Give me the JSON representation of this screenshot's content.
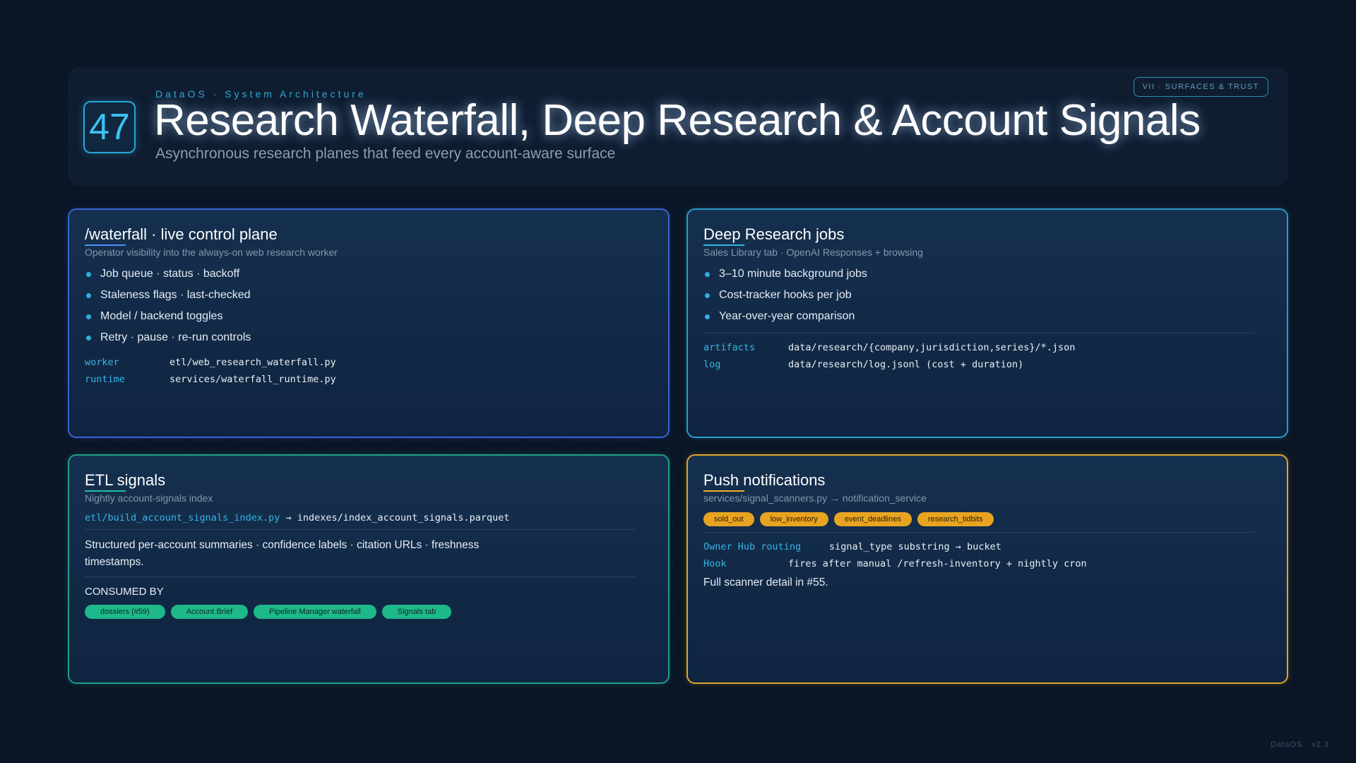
{
  "header": {
    "slide_number": "47",
    "eyebrow": "DataOS · System Architecture",
    "title": "Research Waterfall, Deep Research & Account Signals",
    "subtitle": "Asynchronous research planes that feed every account-aware surface",
    "section_badge": "VII · SURFACES & TRUST"
  },
  "cards": {
    "waterfall": {
      "title": "/waterfall · live control plane",
      "subtitle": "Operator visibility into the always-on web research worker",
      "bullets": [
        "Job queue · status · backoff",
        "Staleness flags · last-checked",
        "Model / backend toggles",
        "Retry · pause · re-run controls"
      ],
      "kv": [
        {
          "k": "worker",
          "v": "etl/web_research_waterfall.py"
        },
        {
          "k": "runtime",
          "v": "services/waterfall_runtime.py"
        }
      ]
    },
    "deep_research": {
      "title": "Deep Research jobs",
      "subtitle": "Sales Library tab · OpenAI Responses + browsing",
      "bullets": [
        "3–10 minute background jobs",
        "Cost-tracker hooks per job",
        "Year-over-year comparison"
      ],
      "kv": [
        {
          "k": "artifacts",
          "v": "data/research/{company,jurisdiction,series}/*.json"
        },
        {
          "k": "log",
          "v": "data/research/log.jsonl (cost + duration)"
        }
      ]
    },
    "etl": {
      "title": "ETL signals",
      "subtitle": "Nightly account-signals index",
      "path_src": "etl/build_account_signals_index.py",
      "path_dst": "→ indexes/index_account_signals.parquet",
      "body": "Structured per-account summaries · confidence labels · citation URLs · freshness timestamps.",
      "consumed_label": "CONSUMED BY",
      "consumers": [
        "dossiers (#59)",
        "Account Brief",
        "Pipeline Manager waterfall",
        "Signals tab"
      ]
    },
    "push": {
      "title": "Push notifications",
      "subtitle": "services/signal_scanners.py → notification_service",
      "tags": [
        "sold_out",
        "low_inventory",
        "event_deadlines",
        "research_tidbits"
      ],
      "kv": [
        {
          "k": "Owner Hub routing",
          "v": "signal_type substring → bucket"
        },
        {
          "k": "Hook",
          "v": "fires after manual /refresh-inventory + nightly cron"
        }
      ],
      "note": "Full scanner detail in #55."
    }
  },
  "footer": "DataOS · v2.3",
  "colors": {
    "background": "#0a1626",
    "accent_blue": "#3a63d6",
    "accent_cyan": "#2a9cc4",
    "accent_green": "#1f9e88",
    "accent_amber": "#e0a42c"
  }
}
